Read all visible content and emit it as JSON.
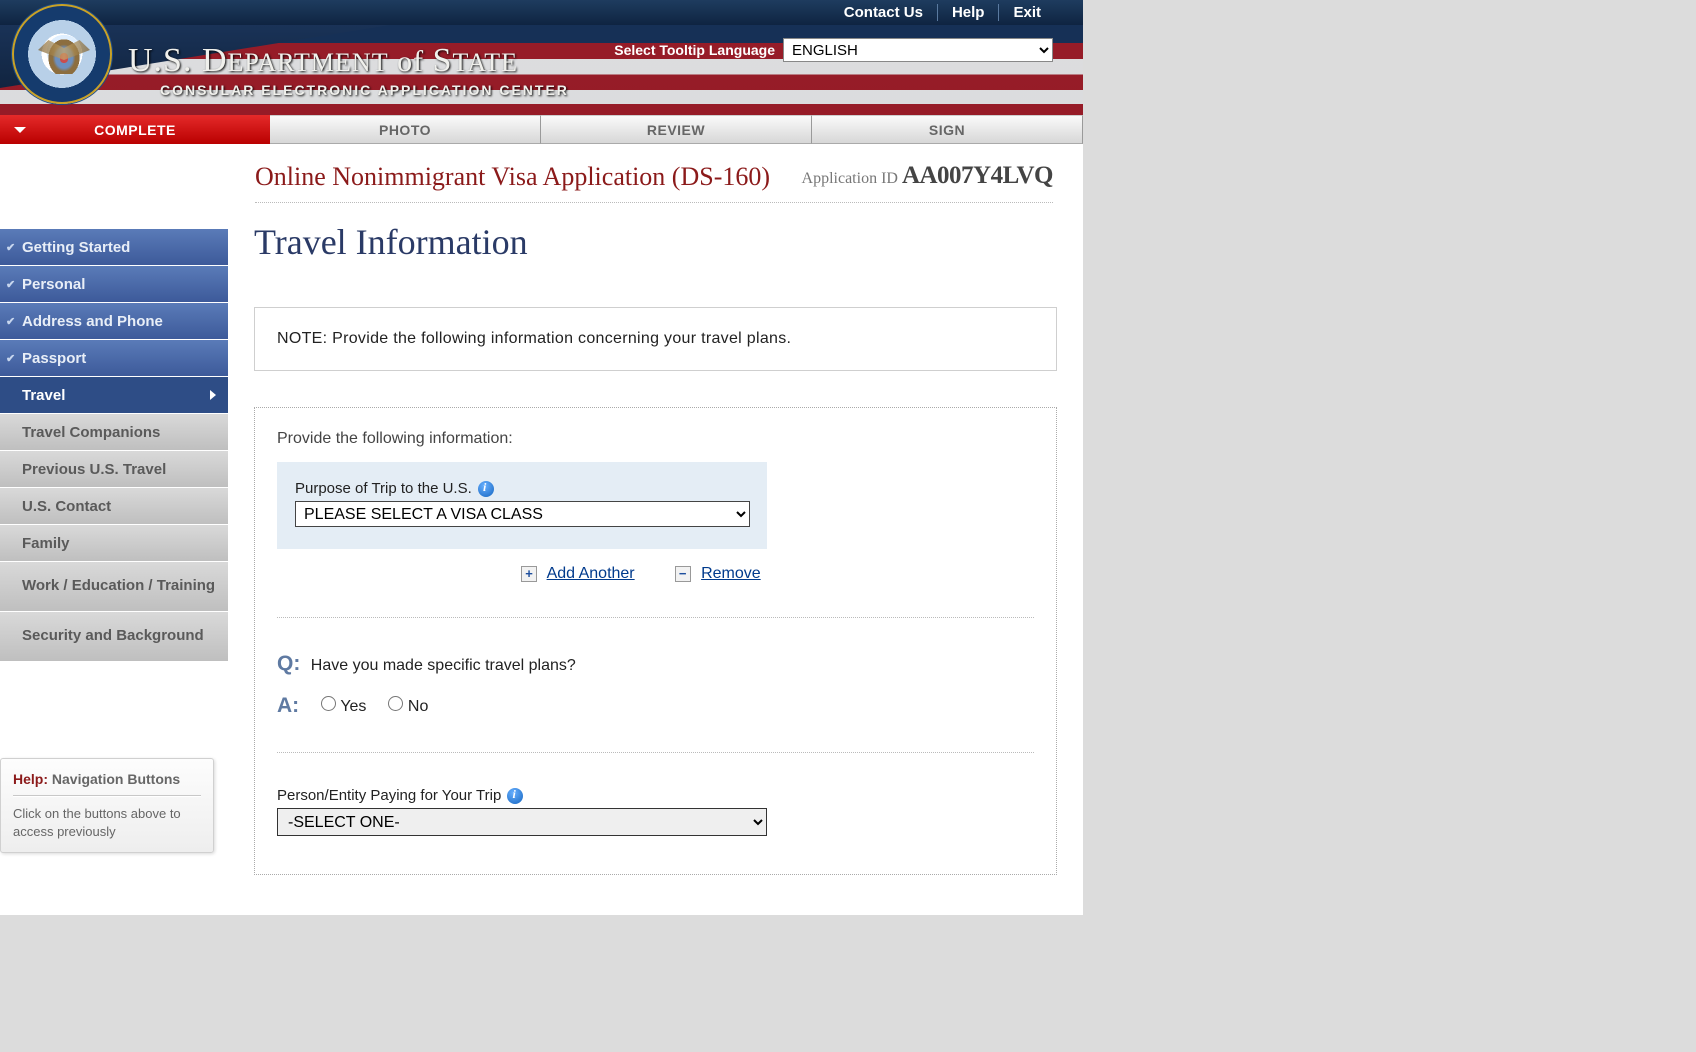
{
  "header": {
    "links": {
      "contact": "Contact Us",
      "help": "Help",
      "exit": "Exit"
    },
    "title_line1_prefix": "U.S. D",
    "title_line1_mid": "epartment",
    "title_line1_of": " of ",
    "title_line1_suffix_cap": "S",
    "title_line1_suffix": "tate",
    "title_line2": "CONSULAR ELECTRONIC APPLICATION CENTER",
    "lang_label": "Select Tooltip Language",
    "lang_value": "ENGLISH"
  },
  "tabs": {
    "complete": "COMPLETE",
    "photo": "PHOTO",
    "review": "REVIEW",
    "sign": "SIGN"
  },
  "app": {
    "title": "Online Nonimmigrant Visa Application (DS-160)",
    "id_label": "Application ID ",
    "id_value": "AA007Y4LVQ"
  },
  "sidebar": {
    "getting_started": "Getting Started",
    "personal": "Personal",
    "address_phone": "Address and Phone",
    "passport": "Passport",
    "travel": "Travel",
    "travel_companions": "Travel Companions",
    "previous_travel": "Previous U.S. Travel",
    "us_contact": "U.S. Contact",
    "family": "Family",
    "work_edu": "Work / Education / Training",
    "security": "Security and Background"
  },
  "page": {
    "title": "Travel Information",
    "note": "NOTE: Provide the following information concerning your travel plans.",
    "section_label": "Provide the following information:",
    "purpose_label": "Purpose of Trip to the U.S.",
    "purpose_value": "PLEASE SELECT A VISA CLASS",
    "add_another": "Add Another",
    "remove": "Remove",
    "q_label": "Q:",
    "q_text": "Have you made specific travel plans?",
    "a_label": "A:",
    "yes": "Yes",
    "no": "No",
    "payer_label": "Person/Entity Paying for Your Trip",
    "payer_value": "-SELECT ONE-"
  },
  "help": {
    "title_bold": "Help:",
    "title_rest": " Navigation Buttons",
    "body": "Click on the buttons above to access previously"
  }
}
